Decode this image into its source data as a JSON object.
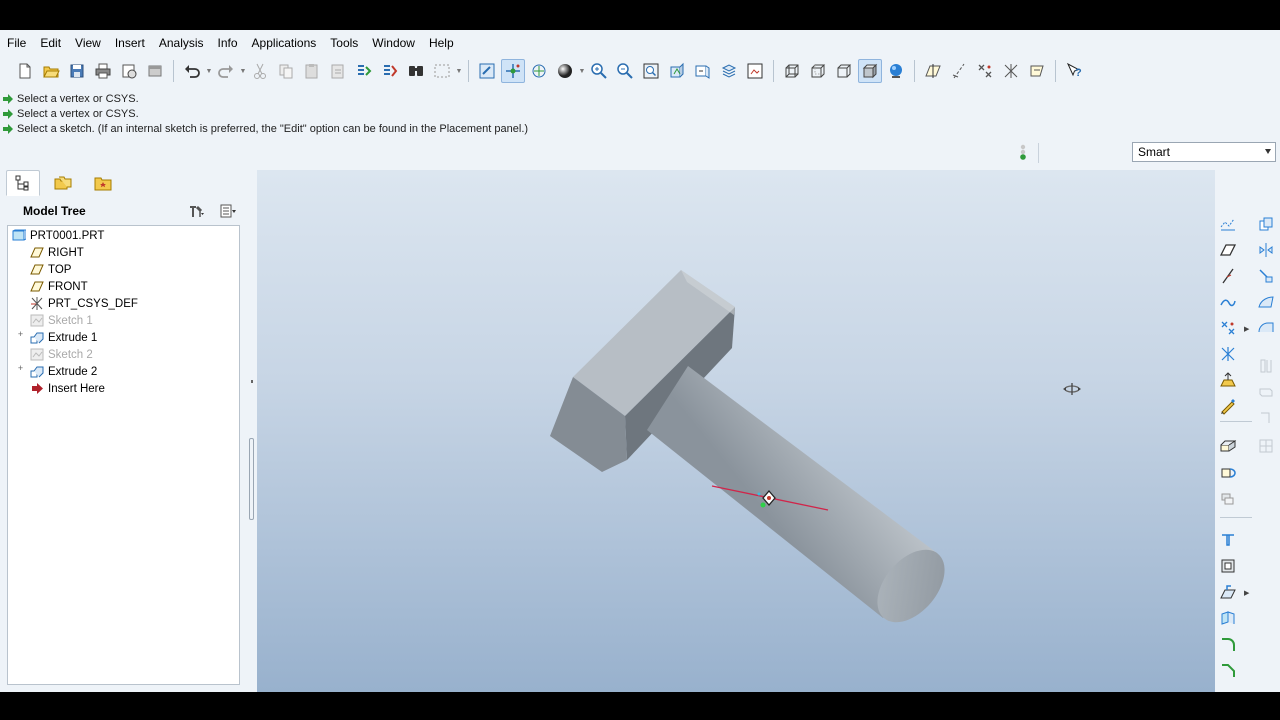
{
  "menu": [
    "File",
    "Edit",
    "View",
    "Insert",
    "Analysis",
    "Info",
    "Applications",
    "Tools",
    "Window",
    "Help"
  ],
  "messages": [
    "Select a vertex or CSYS.",
    "Select a vertex or CSYS.",
    "Select a sketch. (If an internal sketch is preferred, the \"Edit\" option can be found in the Placement panel.)"
  ],
  "filter": {
    "selected": "Smart"
  },
  "model_tree": {
    "title": "Model Tree",
    "items": [
      {
        "label": "PRT0001.PRT",
        "icon": "part-icon"
      },
      {
        "label": "RIGHT",
        "icon": "datum-plane-icon"
      },
      {
        "label": "TOP",
        "icon": "datum-plane-icon"
      },
      {
        "label": "FRONT",
        "icon": "datum-plane-icon"
      },
      {
        "label": "PRT_CSYS_DEF",
        "icon": "csys-icon"
      },
      {
        "label": "Sketch 1",
        "icon": "sketch-icon"
      },
      {
        "label": "Extrude 1",
        "icon": "extrude-icon"
      },
      {
        "label": "Sketch 2",
        "icon": "sketch-icon"
      },
      {
        "label": "Extrude 2",
        "icon": "extrude-icon"
      },
      {
        "label": "Insert Here",
        "icon": "insert-arrow-icon"
      }
    ]
  },
  "colors": {
    "accent": "#2a7fd4",
    "message_arrow": "#2f9a3a",
    "insert_arrow": "#c0392b",
    "model_gray": "#9ea6ae"
  }
}
